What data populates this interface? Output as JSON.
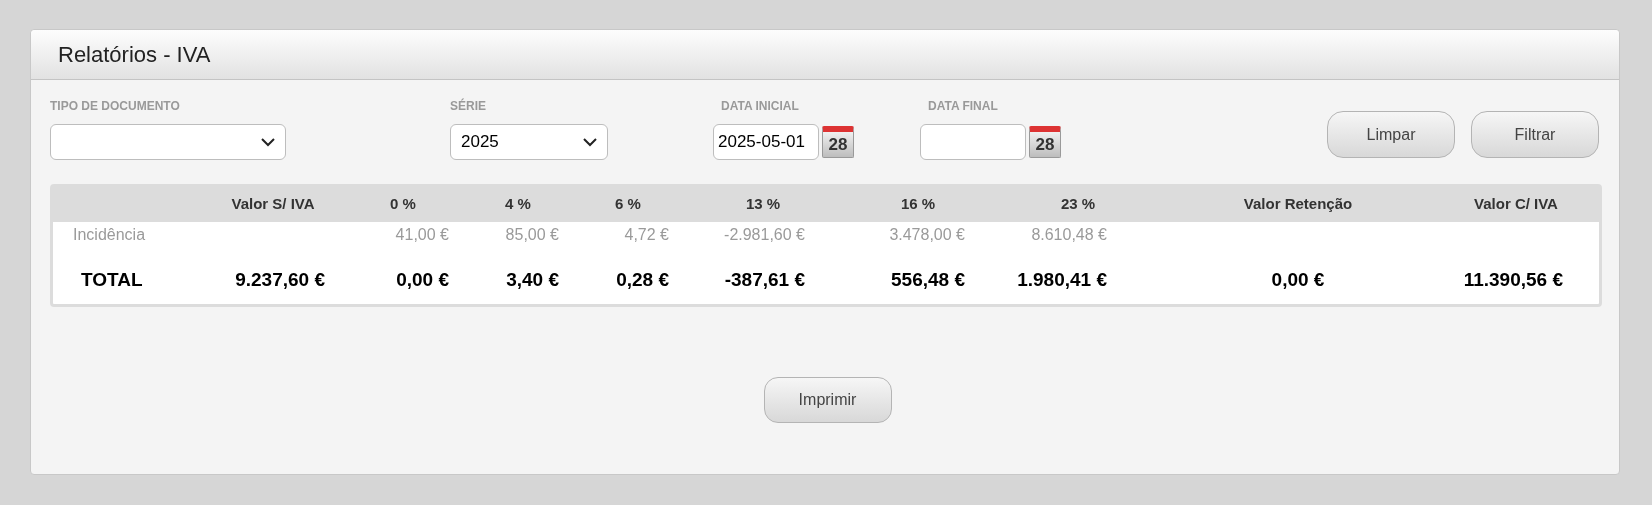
{
  "panel": {
    "title": "Relatórios - IVA"
  },
  "filters": [
    {
      "kind": "select",
      "label": "TIPO DE DOCUMENTO"
    },
    {
      "kind": "select",
      "label": "SÉRIE",
      "value": "2025"
    },
    {
      "kind": "date",
      "label": "DATA INICIAL",
      "value": "2025-05-01",
      "calendar_day": "28"
    },
    {
      "kind": "date",
      "label": "DATA FINAL",
      "calendar_day": "28"
    }
  ],
  "filter_buttons": [
    "Limpar",
    "Filtrar"
  ],
  "table": {
    "columns": [
      null,
      "Valor S/ IVA",
      "0 %",
      "4 %",
      "6 %",
      "13 %",
      "16 %",
      "23 %",
      "Valor Retenção",
      "Valor C/ IVA"
    ],
    "rows": [
      {
        "kind": "incidence",
        "cells": [
          "Incidência",
          null,
          "41,00 €",
          "85,00 €",
          "4,72 €",
          "-2.981,60 €",
          "3.478,00 €",
          "8.610,48 €",
          null,
          null
        ]
      },
      {
        "kind": "total",
        "cells": [
          "TOTAL",
          "9.237,60 €",
          "0,00 €",
          "3,40 €",
          "0,28 €",
          "-387,61 €",
          "556,48 €",
          "1.980,41 €",
          "0,00 €",
          "11.390,56 €"
        ]
      }
    ]
  },
  "print_button": "Imprimir"
}
